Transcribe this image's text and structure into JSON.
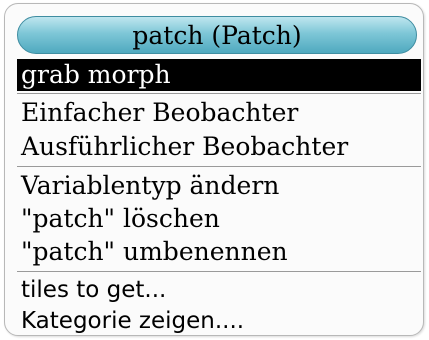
{
  "menu": {
    "title": "patch (Patch)",
    "sections": [
      {
        "items": [
          "grab morph"
        ]
      },
      {
        "items": [
          "Einfacher Beobachter",
          "Ausführlicher Beobachter"
        ]
      },
      {
        "items": [
          "Variablentyp ändern",
          "\"patch\" löschen",
          "\"patch\" umbenennen"
        ]
      },
      {
        "items": [
          "tiles to get...",
          "Kategorie zeigen...."
        ]
      }
    ],
    "selected_item": "grab morph"
  },
  "colors": {
    "title_bar": "#7ec7d7",
    "selected_bg": "#000000",
    "selected_fg": "#ffffff"
  }
}
